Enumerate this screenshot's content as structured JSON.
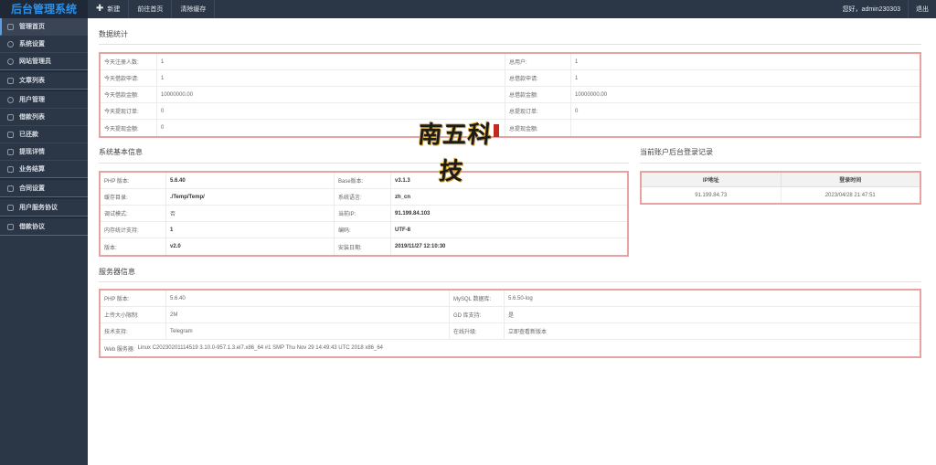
{
  "sidebar": {
    "brand": "后台管理系统",
    "items": [
      {
        "label": "管理首页",
        "icon": "home-icon"
      },
      {
        "label": "系统设置",
        "icon": "gear-icon"
      },
      {
        "label": "网站管理员",
        "icon": "user-icon"
      },
      {
        "label": "文章列表",
        "icon": "document-icon"
      },
      {
        "label": "用户管理",
        "icon": "users-icon"
      },
      {
        "label": "借款列表",
        "icon": "list-icon"
      },
      {
        "label": "已还款",
        "icon": "check-icon"
      },
      {
        "label": "提现详情",
        "icon": "money-icon"
      },
      {
        "label": "业务结算",
        "icon": "settle-icon"
      },
      {
        "label": "合同设置",
        "icon": "contract-icon"
      },
      {
        "label": "用户服务协议",
        "icon": "agreement-icon"
      },
      {
        "label": "借款协议",
        "icon": "loan-agreement-icon"
      }
    ]
  },
  "topbar": {
    "new_label": "新建",
    "home_label": "前往首页",
    "clear_cache_label": "清除缓存",
    "greeting": "您好，admin230303",
    "logout_label": "退出"
  },
  "stats": {
    "title": "数据统计",
    "rows": [
      {
        "l_label": "今天注册人数:",
        "l_value": "1",
        "r_label": "总用户:",
        "r_value": "1"
      },
      {
        "l_label": "今天借款申请:",
        "l_value": "1",
        "r_label": "总借款申请:",
        "r_value": "1"
      },
      {
        "l_label": "今天借款金额:",
        "l_value": "10000000.00",
        "r_label": "总借款金额:",
        "r_value": "10000000.00"
      },
      {
        "l_label": "今天提现订单:",
        "l_value": "0",
        "r_label": "总提现订单:",
        "r_value": "0"
      },
      {
        "l_label": "今天提现金额:",
        "l_value": "0",
        "r_label": "总提现金额:",
        "r_value": ""
      }
    ]
  },
  "sysinfo": {
    "title": "系统基本信息",
    "rows": [
      {
        "l_label": "PHP 版本:",
        "l_value": "5.6.40",
        "r_label": "Base版本:",
        "r_value": "v3.1.3"
      },
      {
        "l_label": "缓存目录:",
        "l_value": "./Temp/Temp/",
        "r_label": "系统语言:",
        "r_value": "zh_cn"
      },
      {
        "l_label": "调试模式:",
        "l_value": "否",
        "r_label": "当前IP:",
        "r_value": "91.199.84.103"
      },
      {
        "l_label": "内存统计支持:",
        "l_value": "1",
        "r_label": "编码:",
        "r_value": "UTF-8"
      },
      {
        "l_label": "版本:",
        "l_value": "v2.0",
        "r_label": "安装日期:",
        "r_value": "2019/11/27 12:10:30"
      }
    ]
  },
  "login": {
    "title": "当前账户后台登录记录",
    "col_ip": "IP地址",
    "col_time": "登录时间",
    "rows": [
      {
        "ip": "91.199.84.73",
        "time": "2023/04/28 21:47:51"
      }
    ]
  },
  "server": {
    "title": "服务器信息",
    "rows": [
      {
        "l_label": "PHP 版本:",
        "l_value": "5.6.40",
        "r_label": "MySQL 数据库:",
        "r_value": "5.6.50-log"
      },
      {
        "l_label": "上传大小限制:",
        "l_value": "2M",
        "r_label": "GD 库支持:",
        "r_value": "是"
      },
      {
        "l_label": "技术支持:",
        "l_value": "Telegram",
        "r_label": "在线升级:",
        "r_value": "立即查看新版本"
      }
    ],
    "web_label": "Web 服务器:",
    "web_value": "Linux C20230201114519 3.10.0-957.1.3.el7.x86_64 #1 SMP Thu Nov 29 14:49:43 UTC 2018 x86_64"
  },
  "watermark_text": "南五科技"
}
